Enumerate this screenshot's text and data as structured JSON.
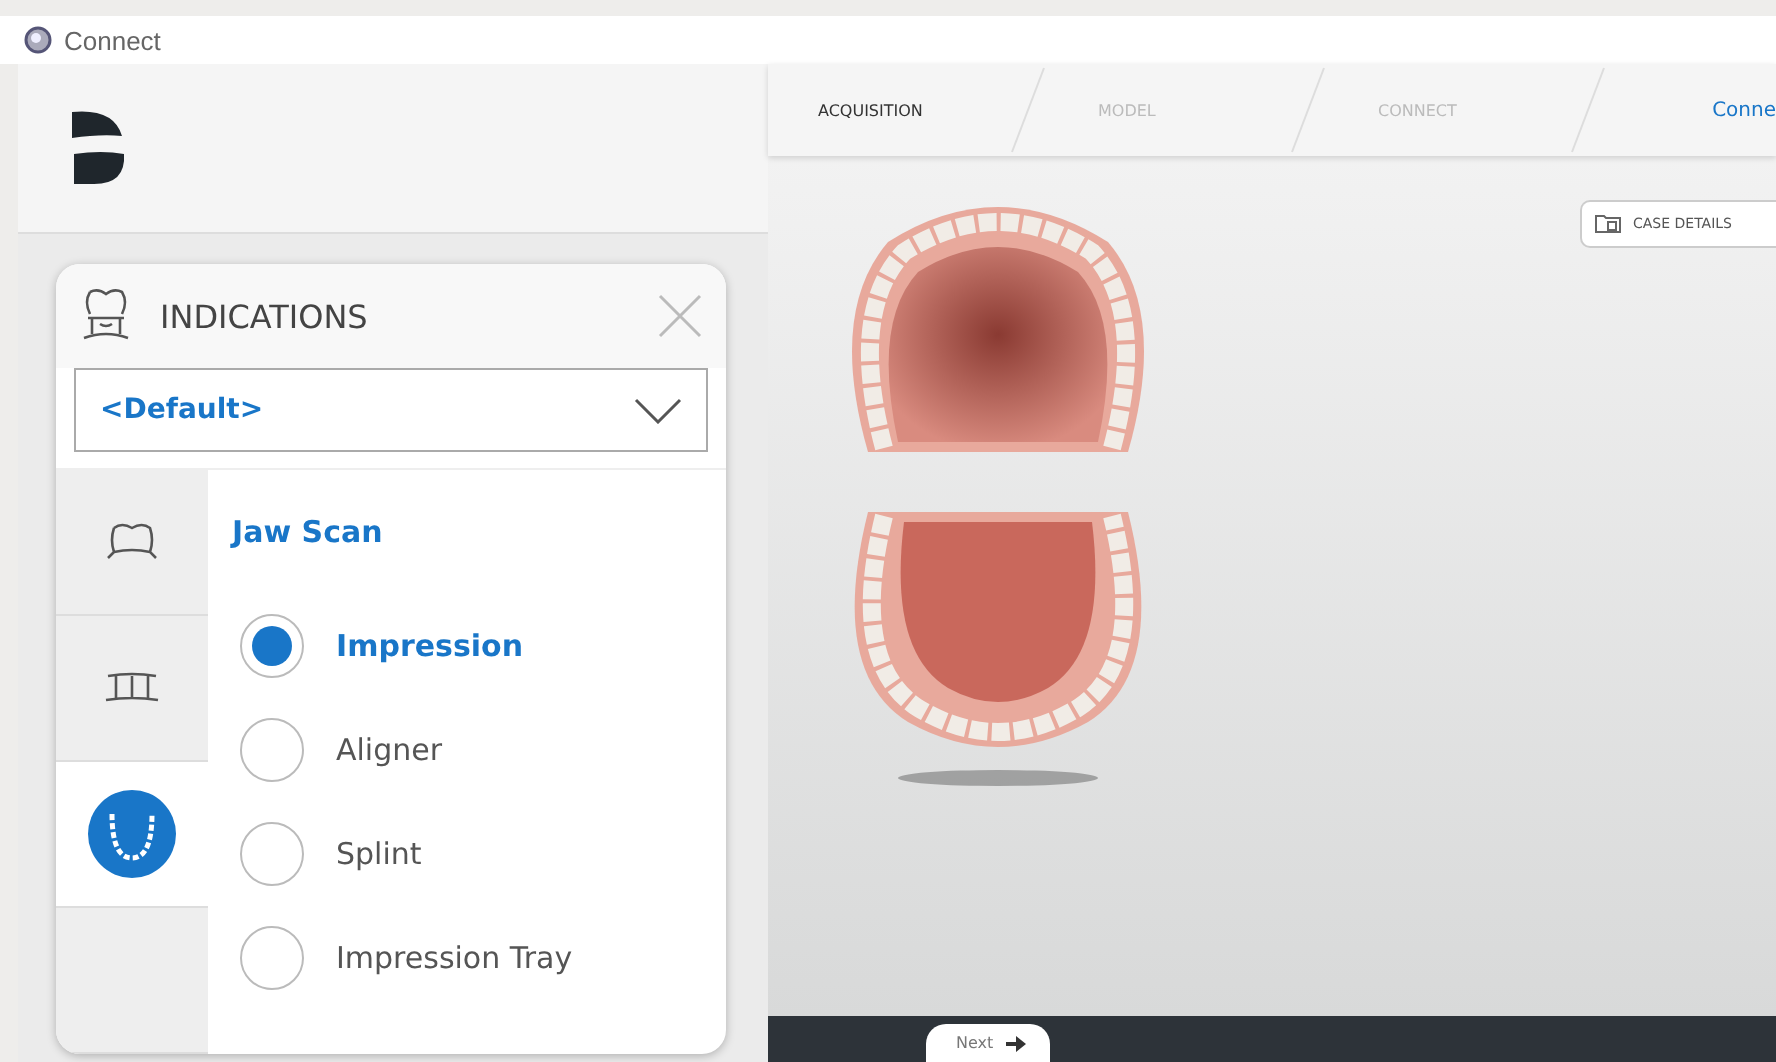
{
  "window": {
    "title": "Connect"
  },
  "indications": {
    "title": "INDICATIONS",
    "dropdown": {
      "value": "<Default>"
    },
    "tabs": [
      {
        "kind": "crown",
        "selected": false
      },
      {
        "kind": "bridge",
        "selected": false
      },
      {
        "kind": "jaw",
        "selected": true
      },
      {
        "kind": "empty",
        "selected": false
      }
    ],
    "section_title": "Jaw Scan",
    "options": [
      {
        "label": "Impression",
        "selected": true
      },
      {
        "label": "Aligner",
        "selected": false
      },
      {
        "label": "Splint",
        "selected": false
      },
      {
        "label": "Impression Tray",
        "selected": false
      }
    ]
  },
  "steps": [
    {
      "label": "ACQUISITION",
      "selected": true
    },
    {
      "label": "MODEL",
      "selected": false
    },
    {
      "label": "CONNECT",
      "selected": false
    }
  ],
  "product_link": "Conne",
  "case_details_button": "CASE DETAILS",
  "next_button": "Next"
}
